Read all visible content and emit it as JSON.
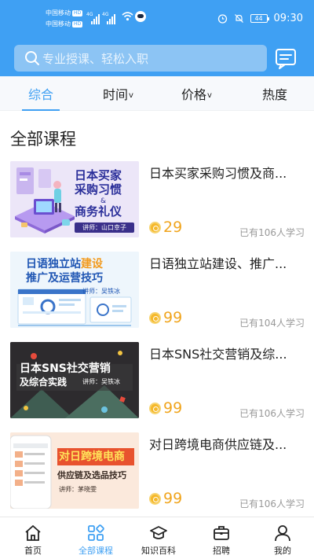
{
  "status_bar": {
    "carrier1": "中国移动",
    "carrier2": "中国移动",
    "hd": "HD",
    "net1": "4G",
    "net2": "4G",
    "battery": "44",
    "time": "09:30"
  },
  "header": {
    "search_placeholder": "专业授课、轻松入职",
    "message_icon": "message-icon"
  },
  "filters": [
    {
      "label": "综合",
      "active": true
    },
    {
      "label": "时间",
      "caret": "v"
    },
    {
      "label": "价格",
      "caret": "v"
    },
    {
      "label": "热度"
    }
  ],
  "section_title": "全部课程",
  "courses": [
    {
      "title": "日本买家采购习惯及商...",
      "price": "29",
      "learners": "已有106人学习",
      "thumb": {
        "line1": "日本买家",
        "line2": "采购习惯",
        "line3": "&",
        "line4": "商务礼仪",
        "lecturer": "讲师：山口幸子"
      }
    },
    {
      "title": "日语独立站建设、推广...",
      "price": "99",
      "learners": "已有104人学习",
      "thumb": {
        "line1a": "日语独立站",
        "line1b": "建设",
        "line2": "推广及运营技巧",
        "lecturer": "讲师：吴铁冰"
      }
    },
    {
      "title": "日本SNS社交营销及综...",
      "price": "99",
      "learners": "已有106人学习",
      "thumb": {
        "line1": "日本SNS社交营销",
        "line2": "及综合实践",
        "lecturer": "讲师：吴铁冰"
      }
    },
    {
      "title": "对日跨境电商供应链及...",
      "price": "99",
      "learners": "已有106人学习",
      "thumb": {
        "line1": "对日跨境电商",
        "line2": "供应链及选品技巧",
        "lecturer": "讲师：茅晓雯"
      }
    }
  ],
  "tabbar": [
    {
      "label": "首页",
      "icon": "home-icon"
    },
    {
      "label": "全部课程",
      "icon": "grid-icon",
      "active": true
    },
    {
      "label": "知识百科",
      "icon": "graduation-cap-icon"
    },
    {
      "label": "招聘",
      "icon": "briefcase-icon"
    },
    {
      "label": "我的",
      "icon": "user-icon"
    }
  ],
  "colors": {
    "primary": "#3fa0f3",
    "price": "#f0a51e",
    "muted": "#999999"
  }
}
